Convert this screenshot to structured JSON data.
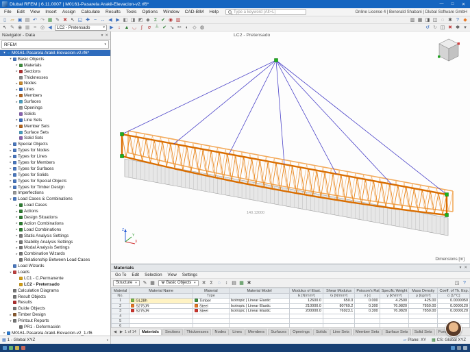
{
  "window": {
    "title": "Dlubal RFEM | 6.11.0007 | M0161-Pasarela Arakil-Elevacion-v2.rf6*",
    "controls": {
      "minimize": "—",
      "maximize": "□",
      "close": "✕"
    },
    "search_placeholder": "Type a keyword (Alt+L)",
    "license": "Online License 4 | Benerald Shabani | Dlubal Software GmbH"
  },
  "menubar": {
    "items": [
      "File",
      "Edit",
      "View",
      "Insert",
      "Assign",
      "Calculate",
      "Results",
      "Tools",
      "Options",
      "Window",
      "CAD-BIM",
      "Help"
    ]
  },
  "toolbars": {
    "load_case": "LC2 - Pretensado",
    "row1_left": [
      {
        "n": "new-model-icon",
        "g": "▯",
        "c": "#5b7fae"
      },
      {
        "n": "open-model-icon",
        "g": "▱",
        "c": "#c9993a"
      },
      {
        "n": "save-model-icon",
        "g": "▣",
        "c": "#3a6fbf"
      },
      {
        "n": "print-icon",
        "g": "▤",
        "c": "#6b6b6b"
      },
      {
        "n": "undo-icon",
        "g": "↶",
        "c": "#3a6fbf"
      },
      {
        "n": "redo-icon",
        "g": "↷",
        "c": "#9a9a9a"
      },
      {
        "n": "input-table-icon",
        "g": "▦",
        "c": "#3f8f3f"
      },
      {
        "n": "edit-parameters-icon",
        "g": "✎",
        "c": "#6b6b6b"
      },
      {
        "n": "delete-object-icon",
        "g": "✖",
        "c": "#c04040"
      },
      {
        "n": "select-icon",
        "g": "↖",
        "c": "#444444"
      },
      {
        "n": "zoom-window-icon",
        "g": "◱",
        "c": "#3a6fbf"
      },
      {
        "n": "zoom-in-icon",
        "g": "✚",
        "c": "#3a6fbf"
      },
      {
        "n": "zoom-out-icon",
        "g": "−",
        "c": "#3a6fbf"
      },
      {
        "n": "pan-icon",
        "g": "↔",
        "c": "#3a6fbf"
      },
      {
        "n": "previous-view-icon",
        "g": "◀",
        "c": "#3a6fbf"
      },
      {
        "n": "next-view-icon",
        "g": "▶",
        "c": "#3a6fbf"
      },
      {
        "n": "view-x-icon",
        "g": "◧",
        "c": "#777777"
      },
      {
        "n": "view-y-icon",
        "g": "◨",
        "c": "#777777"
      },
      {
        "n": "view-z-icon",
        "g": "◩",
        "c": "#777777"
      },
      {
        "n": "isometric-view-icon",
        "g": "◆",
        "c": "#777777"
      },
      {
        "n": "load-case-manager-icon",
        "g": "Σ",
        "c": "#2e7d32"
      },
      {
        "n": "calculate-all-icon",
        "g": "✔",
        "c": "#2e7d32"
      },
      {
        "n": "show-results-icon",
        "g": "◉",
        "c": "#b03030"
      },
      {
        "n": "result-tables-icon",
        "g": "▥",
        "c": "#b03030"
      }
    ],
    "row1_right": [
      {
        "n": "data-navigator-icon",
        "g": "▥",
        "c": "#555555"
      },
      {
        "n": "display-navigator-icon",
        "g": "▦",
        "c": "#555555"
      },
      {
        "n": "views-navigator-icon",
        "g": "◨",
        "c": "#555555"
      },
      {
        "n": "panel-toggle-icon",
        "g": "◫",
        "c": "#555555"
      },
      {
        "n": "find-icon",
        "g": "◌",
        "c": "#555555"
      },
      {
        "n": "settings-icon",
        "g": "✱",
        "c": "#555555"
      },
      {
        "n": "help-icon",
        "g": "?",
        "c": "#2e6cc0"
      },
      {
        "n": "dlubal-logo-icon",
        "g": "◆",
        "c": "#e87722"
      }
    ],
    "row2_left_a": [
      {
        "n": "select-objects-icon",
        "g": "↖",
        "c": "#444444"
      },
      {
        "n": "edit-objects-icon",
        "g": "✎",
        "c": "#777777"
      },
      {
        "n": "snap-icon",
        "g": "◉",
        "c": "#777777"
      },
      {
        "n": "grid-icon",
        "g": "▦",
        "c": "#999999"
      },
      {
        "n": "guidelines-icon",
        "g": "≡",
        "c": "#999999"
      },
      {
        "n": "object-snap-icon",
        "g": "◎",
        "c": "#777777"
      }
    ],
    "prev_load_case": {
      "n": "previous-load-case-icon",
      "g": "◀",
      "c": "#3a6fbf"
    },
    "next_load_case": {
      "n": "next-load-case-icon",
      "g": "▶",
      "c": "#3a6fbf"
    },
    "row2_left_b": [
      {
        "n": "show-loads-icon",
        "g": "↓",
        "c": "#b03030"
      },
      {
        "n": "show-supports-icon",
        "g": "▲",
        "c": "#2e7d32"
      },
      {
        "n": "deformed-shape-icon",
        "g": "◡",
        "c": "#b03030"
      },
      {
        "n": "internal-forces-icon",
        "g": "∫",
        "c": "#b03030"
      },
      {
        "n": "stresses-icon",
        "g": "σ",
        "c": "#b03030"
      },
      {
        "n": "support-reactions-icon",
        "g": "┴",
        "c": "#2e7d32"
      },
      {
        "n": "design-check-icon",
        "g": "✔",
        "c": "#2e7d32"
      },
      {
        "n": "measure-icon",
        "g": "↘",
        "c": "#555555"
      },
      {
        "n": "clipping-box-icon",
        "g": "✂",
        "c": "#555555"
      },
      {
        "n": "visibility-icon",
        "g": "◐",
        "c": "#555555"
      },
      {
        "n": "user-views-icon",
        "g": "◇",
        "c": "#555555"
      },
      {
        "n": "rendering-icon",
        "g": "◍",
        "c": "#555555"
      }
    ],
    "row2_right": [
      {
        "n": "undo-view-icon",
        "g": "↺",
        "c": "#3a6fbf"
      },
      {
        "n": "redo-view-icon",
        "g": "↻",
        "c": "#9a9a9a"
      },
      {
        "n": "screenshot-icon",
        "g": "◫",
        "c": "#555555"
      },
      {
        "n": "delete-results-icon",
        "g": "✖",
        "c": "#c04040"
      },
      {
        "n": "display-settings-icon",
        "g": "✱",
        "c": "#555555"
      },
      {
        "n": "pin-toolbar-icon",
        "g": "▾",
        "c": "#555555"
      }
    ]
  },
  "navigator": {
    "title": "Navigator - Data",
    "root": "RFEM",
    "title_icons": [
      {
        "n": "pin-icon",
        "g": "▾"
      },
      {
        "n": "close-icon",
        "g": "✕"
      }
    ],
    "tree": [
      {
        "l": "M0161-Pasarela Arakil-Elevacion-v2.rf6*",
        "d": 0,
        "a": "e",
        "c": "#2e7dd1",
        "sel": true
      },
      {
        "l": "Basic Objects",
        "d": 1,
        "a": "e",
        "c": "#4a78c0"
      },
      {
        "l": "Materials",
        "d": 2,
        "a": "c",
        "c": "#3f8f3f"
      },
      {
        "l": "Sections",
        "d": 2,
        "a": "c",
        "c": "#b03030"
      },
      {
        "l": "Thicknesses",
        "d": 2,
        "a": "n",
        "c": "#888888"
      },
      {
        "l": "Nodes",
        "d": 2,
        "a": "c",
        "c": "#c98a2e"
      },
      {
        "l": "Lines",
        "d": 2,
        "a": "c",
        "c": "#3a6fbf"
      },
      {
        "l": "Members",
        "d": 2,
        "a": "c",
        "c": "#b5651d"
      },
      {
        "l": "Surfaces",
        "d": 2,
        "a": "c",
        "c": "#4aa0c0"
      },
      {
        "l": "Openings",
        "d": 2,
        "a": "n",
        "c": "#999999"
      },
      {
        "l": "Solids",
        "d": 2,
        "a": "n",
        "c": "#8a62b0"
      },
      {
        "l": "Line Sets",
        "d": 2,
        "a": "c",
        "c": "#3a6fbf"
      },
      {
        "l": "Member Sets",
        "d": 2,
        "a": "c",
        "c": "#b5651d"
      },
      {
        "l": "Surface Sets",
        "d": 2,
        "a": "n",
        "c": "#4aa0c0"
      },
      {
        "l": "Solid Sets",
        "d": 2,
        "a": "n",
        "c": "#8a62b0"
      },
      {
        "l": "Special Objects",
        "d": 1,
        "a": "c",
        "c": "#4a78c0"
      },
      {
        "l": "Types for Nodes",
        "d": 1,
        "a": "c",
        "c": "#4a78c0"
      },
      {
        "l": "Types for Lines",
        "d": 1,
        "a": "c",
        "c": "#4a78c0"
      },
      {
        "l": "Types for Members",
        "d": 1,
        "a": "c",
        "c": "#4a78c0"
      },
      {
        "l": "Types for Surfaces",
        "d": 1,
        "a": "c",
        "c": "#4a78c0"
      },
      {
        "l": "Types for Solids",
        "d": 1,
        "a": "c",
        "c": "#4a78c0"
      },
      {
        "l": "Types for Special Objects",
        "d": 1,
        "a": "c",
        "c": "#4a78c0"
      },
      {
        "l": "Types for Timber Design",
        "d": 1,
        "a": "c",
        "c": "#4a78c0"
      },
      {
        "l": "Imperfections",
        "d": 1,
        "a": "n",
        "c": "#999999"
      },
      {
        "l": "Load Cases & Combinations",
        "d": 1,
        "a": "e",
        "c": "#4a78c0"
      },
      {
        "l": "Load Cases",
        "d": 2,
        "a": "c",
        "c": "#2e7d32"
      },
      {
        "l": "Actions",
        "d": 2,
        "a": "c",
        "c": "#2e7d32"
      },
      {
        "l": "Design Situations",
        "d": 2,
        "a": "c",
        "c": "#2e7d32"
      },
      {
        "l": "Action Combinations",
        "d": 2,
        "a": "c",
        "c": "#2e7d32"
      },
      {
        "l": "Load Combinations",
        "d": 2,
        "a": "c",
        "c": "#2e7d32"
      },
      {
        "l": "Static Analysis Settings",
        "d": 2,
        "a": "c",
        "c": "#777777"
      },
      {
        "l": "Stability Analysis Settings",
        "d": 2,
        "a": "c",
        "c": "#777777"
      },
      {
        "l": "Modal Analysis Settings",
        "d": 2,
        "a": "c",
        "c": "#777777"
      },
      {
        "l": "Combination Wizards",
        "d": 2,
        "a": "c",
        "c": "#777777"
      },
      {
        "l": "Relationship Between Load Cases",
        "d": 2,
        "a": "n",
        "c": "#777777"
      },
      {
        "l": "Load Wizards",
        "d": 1,
        "a": "n",
        "c": "#4a78c0"
      },
      {
        "l": "Loads",
        "d": 1,
        "a": "e",
        "c": "#c04040"
      },
      {
        "l": "LC1 - C.Permanente",
        "d": 2,
        "a": "n",
        "c": "#d4a017"
      },
      {
        "l": "LC2 - Pretensado",
        "d": 2,
        "a": "n",
        "c": "#d4a017",
        "b": true
      },
      {
        "l": "Calculation Diagrams",
        "d": 1,
        "a": "n",
        "c": "#777777"
      },
      {
        "l": "Result Objects",
        "d": 1,
        "a": "n",
        "c": "#777777"
      },
      {
        "l": "Results",
        "d": 1,
        "a": "n",
        "c": "#b03030"
      },
      {
        "l": "Guide Objects",
        "d": 1,
        "a": "n",
        "c": "#777777"
      },
      {
        "l": "Timber Design",
        "d": 1,
        "a": "c",
        "c": "#8a5a2e"
      },
      {
        "l": "Printout Reports",
        "d": 1,
        "a": "e",
        "c": "#777777"
      },
      {
        "l": "PR1 - Deformación",
        "d": 2,
        "a": "n",
        "c": "#777777"
      },
      {
        "l": "M0161-Pasarela Arakil-Elevacion-v2_1.rf6",
        "d": 0,
        "a": "c",
        "c": "#2e7dd1"
      }
    ]
  },
  "viewport": {
    "label": "LC2 - Pretensado",
    "dimensions_label": "Dimensions [m]",
    "annotation": "140.13000",
    "colors": {
      "truss": "#d96d00",
      "truss_far": "#f2a24a",
      "cables": "#4a42c8",
      "supports": "#1db21d",
      "deck": "#e6e6e6"
    }
  },
  "materials": {
    "title": "Materials",
    "title_icons": [
      {
        "n": "pin-icon",
        "g": "▾"
      },
      {
        "n": "close-panel-icon",
        "g": "✕"
      }
    ],
    "menus": [
      "Go To",
      "Edit",
      "Selection",
      "View",
      "Settings"
    ],
    "structure_combo": "Structure",
    "filter_combo": "Basic Objects",
    "toolbar_icons_a": [
      {
        "n": "edit-table-icon",
        "g": "✎",
        "c": "#555555"
      },
      {
        "n": "table-view-icon",
        "g": "▦",
        "c": "#555555"
      }
    ],
    "toolbar_icons_b": [
      {
        "n": "clear-filter-icon",
        "g": "✖",
        "c": "#888888"
      },
      {
        "n": "sum-icon",
        "g": "Σ",
        "c": "#555555"
      },
      {
        "n": "search-table-icon",
        "g": "◌",
        "c": "#3a6fbf"
      },
      {
        "n": "sort-icon",
        "g": "↕",
        "c": "#555555"
      },
      {
        "n": "print-table-icon",
        "g": "▤",
        "c": "#555555"
      },
      {
        "n": "export-excel-icon",
        "g": "▦",
        "c": "#2e7d32"
      },
      {
        "n": "table-settings-icon",
        "g": "✱",
        "c": "#555555"
      }
    ],
    "toolbar_icons_right": [
      {
        "n": "expand-table-icon",
        "g": "◳",
        "c": "#555555"
      },
      {
        "n": "table-help-icon",
        "g": "?",
        "c": "#2e6cc0"
      }
    ],
    "pager": "1 of 14",
    "table": {
      "headers": [
        "Material",
        "Material Name",
        "Material",
        "Material Model",
        "Modulus of Elast.",
        "Shear Modulus",
        "Poisson's Ratio",
        "Specific Weight",
        "Mass Density",
        "Coeff. of Th. Exp."
      ],
      "units": [
        "No.",
        "",
        "Type",
        "",
        "E [N/mm²]",
        "G [N/mm²]",
        "ν [-]",
        "γ [kN/m³]",
        "ρ [kg/m³]",
        "α [1/°C]"
      ],
      "rows": [
        {
          "no": "1",
          "name": "GL28h",
          "name_color": "#7ab648",
          "type": "Timber",
          "type_color": "#3f8f3f",
          "model": "Isotropic | Linear Elastic",
          "E": "12600.0",
          "G": "650.0",
          "nu": "0.000",
          "gamma": "4.2500",
          "rho": "425.00",
          "alpha": "0.0000050"
        },
        {
          "no": "2",
          "name": "S275JR",
          "name_color": "#e87722",
          "type": "Steel",
          "type_color": "#e87722",
          "model": "Isotropic | Linear Elastic",
          "E": "210000.0",
          "G": "80769.2",
          "nu": "0.300",
          "gamma": "76.9820",
          "rho": "7850.00",
          "alpha": "0.0000120"
        },
        {
          "no": "3",
          "name": "S275JR",
          "name_color": "#d0342c",
          "type": "Steel",
          "type_color": "#d0342c",
          "model": "Isotropic | Linear Elastic",
          "E": "200000.0",
          "G": "76923.1",
          "nu": "0.300",
          "gamma": "76.9820",
          "rho": "7850.00",
          "alpha": "0.0000120"
        }
      ],
      "empty_row_numbers": [
        "4",
        "5",
        "6"
      ]
    },
    "tabs": [
      "Materials",
      "Sections",
      "Thicknesses",
      "Nodes",
      "Lines",
      "Members",
      "Surfaces",
      "Openings",
      "Solids",
      "Line Sets",
      "Member Sets",
      "Surface Sets",
      "Solid Sets",
      "Formulas"
    ],
    "active_tab": "Materials"
  },
  "statusbar": {
    "cs_combo": "1 - Global XYZ",
    "items": [
      {
        "g": "▱",
        "c": "#3a6fbf",
        "label": "Plane: XY"
      },
      {
        "g": "▦",
        "c": "#2e7d32",
        "label": "CS: Global XYZ"
      }
    ]
  },
  "taskbar": {
    "left_colors": [
      "#5a9bd4",
      "#6fbf73",
      "#e0c04a",
      "#d46a5a"
    ],
    "right_colors": [
      "#5a9bd4",
      "#8899aa",
      "#aabbcc"
    ]
  }
}
